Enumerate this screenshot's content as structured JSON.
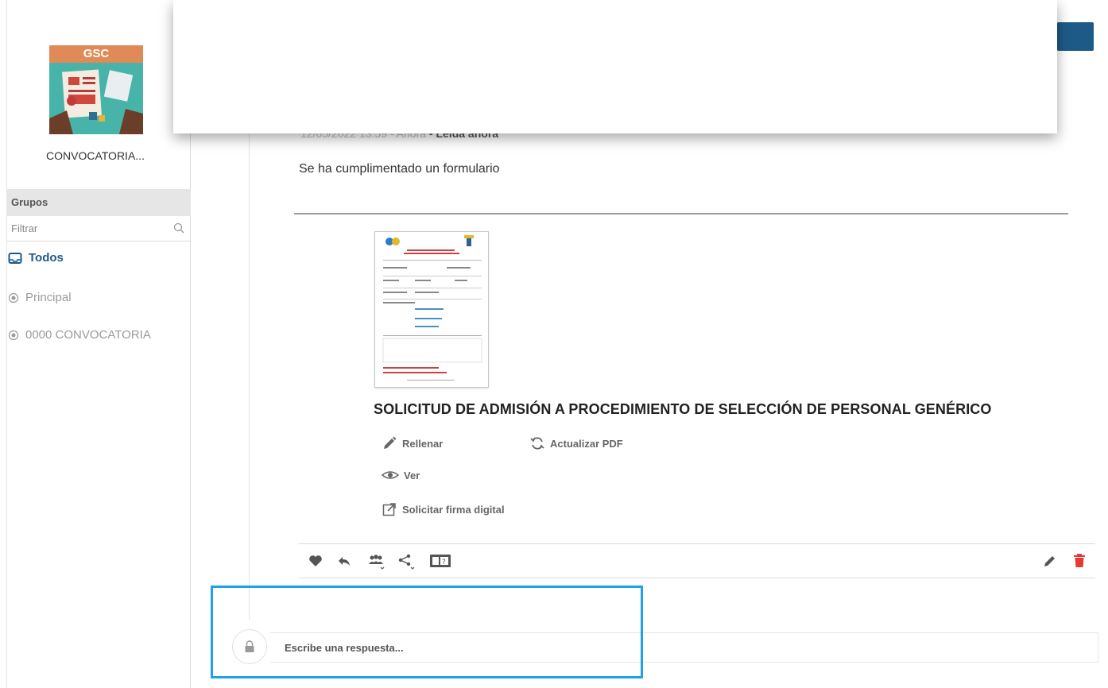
{
  "sidebar": {
    "logo_text": "GSC",
    "convocatoria_name": "CONVOCATORIA...",
    "groups_label": "Grupos",
    "filter_placeholder": "Filtrar",
    "items": [
      {
        "label": "Todos",
        "icon": "inbox-icon",
        "active": true
      },
      {
        "label": "Principal",
        "icon": "radio-dot-icon",
        "active": false
      },
      {
        "label": "0000 CONVOCATORIA",
        "icon": "radio-dot-icon",
        "active": false
      }
    ]
  },
  "message": {
    "meta_date": "12/05/2022 13:59 - Ahora",
    "meta_status": "- Leída ahora",
    "text": "Se ha cumplimentado un formulario",
    "document_title": "SOLICITUD DE ADMISIÓN A PROCEDIMIENTO DE SELECCIÓN DE PERSONAL GENÉRICO",
    "actions": {
      "fill": "Rellenar",
      "refresh_pdf": "Actualizar PDF",
      "view": "Ver",
      "request_signature": "Solicitar firma digital"
    }
  },
  "toolbar": {
    "icons": [
      "heart-icon",
      "reply-icon",
      "group-icon",
      "share-icon",
      "id-card-icon",
      "edit-icon",
      "trash-icon"
    ]
  },
  "reply": {
    "placeholder": "Escribe una respuesta..."
  },
  "colors": {
    "accent": "#1e5a88",
    "highlight": "#1ea1e6",
    "delete": "#e53935"
  }
}
